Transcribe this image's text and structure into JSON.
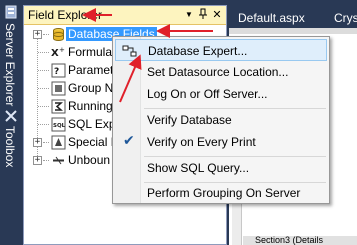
{
  "left_strip": {
    "server_explorer_label": "Server Explorer",
    "toolbox_label": "Toolbox"
  },
  "field_explorer": {
    "title": "Field Explorer",
    "dropdown_glyph": "▼",
    "pin_glyph": "📌",
    "close_glyph": "✕",
    "tree": [
      {
        "label": "Database Fields",
        "icon": "database-icon",
        "expander": "+",
        "selected": true
      },
      {
        "label": "Formula",
        "icon": "formula-icon",
        "expander": "",
        "selected": false
      },
      {
        "label": "Paramet",
        "icon": "parameter-icon",
        "expander": "",
        "selected": false
      },
      {
        "label": "Group N",
        "icon": "group-icon",
        "expander": "",
        "selected": false
      },
      {
        "label": "Running",
        "icon": "running-total-icon",
        "expander": "",
        "selected": false
      },
      {
        "label": "SQL Exp",
        "icon": "sql-icon",
        "expander": "",
        "selected": false
      },
      {
        "label": "Special F",
        "icon": "special-field-icon",
        "expander": "+",
        "selected": false
      },
      {
        "label": "Unboun",
        "icon": "unbound-icon",
        "expander": "+",
        "selected": false
      }
    ]
  },
  "document_tabs": [
    {
      "label": "Default.aspx"
    },
    {
      "label": "Cryst"
    }
  ],
  "designer": {
    "section_label": "Section3 (Details"
  },
  "context_menu": {
    "items": [
      {
        "label": "Database Expert...",
        "highlighted": true,
        "checked": false
      },
      {
        "label": "Set Datasource Location...",
        "highlighted": false,
        "checked": false
      },
      {
        "label": "Log On or Off Server...",
        "highlighted": false,
        "checked": false
      },
      {
        "label": "Verify Database",
        "highlighted": false,
        "checked": false
      },
      {
        "label": "Verify on Every Print",
        "highlighted": false,
        "checked": true
      },
      {
        "label": "Show SQL Query...",
        "highlighted": false,
        "checked": false
      },
      {
        "label": "Perform Grouping On Server",
        "highlighted": false,
        "checked": false
      }
    ],
    "check_glyph": "✔"
  },
  "colors": {
    "annotation_arrow": "#e0202a",
    "selection": "#3399ff",
    "frame": "#293955",
    "title_bar": "#fdf4bf"
  }
}
